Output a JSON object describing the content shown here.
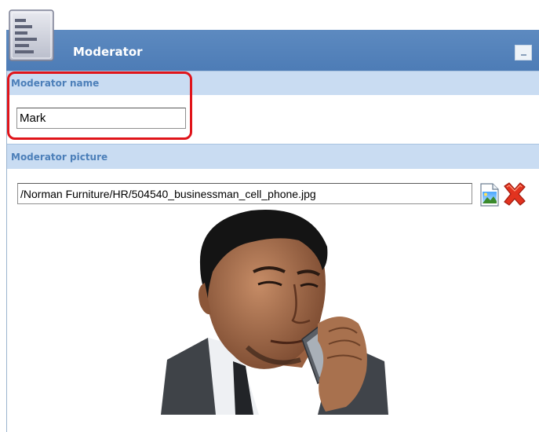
{
  "header": {
    "title": "Moderator"
  },
  "moderator_name": {
    "label": "Moderator name",
    "value": "Mark"
  },
  "moderator_picture": {
    "label": "Moderator picture",
    "path": "/Norman Furniture/HR/504540_businessman_cell_phone.jpg"
  },
  "icons": {
    "panel": "document-list-icon",
    "collapse": "minimize-icon",
    "browse": "select-image-icon",
    "remove": "delete-x-icon"
  },
  "colors": {
    "header": "#4d7cb6",
    "section_bg": "#c9dcf2",
    "label": "#4c7fb9",
    "highlight": "#e0141a"
  }
}
